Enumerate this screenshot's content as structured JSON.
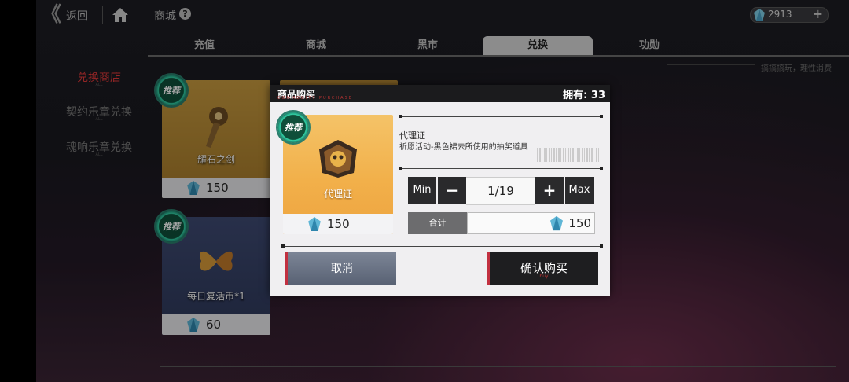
{
  "topbar": {
    "back_label": "返回",
    "mall_label": "商城",
    "currency_amount": "2913"
  },
  "tabs": [
    {
      "label": "充值"
    },
    {
      "label": "商城"
    },
    {
      "label": "黑市"
    },
    {
      "label": "兑换",
      "active": true
    },
    {
      "label": "功勋"
    }
  ],
  "tagline": "搞搞搞玩，理性消费",
  "side_menu": [
    {
      "label": "兑换商店",
      "sub": "ALL",
      "active": true
    },
    {
      "label": "契约乐章兑换",
      "sub": "ALL"
    },
    {
      "label": "魂响乐章兑换",
      "sub": "ALL"
    }
  ],
  "cards": [
    {
      "badge": "推荐",
      "name": "耀石之剑",
      "price": "150"
    },
    {
      "badge": "推荐",
      "name": "每日复活币*1",
      "price": "60"
    }
  ],
  "modal": {
    "title": "商品购买",
    "subtitle": "COMMODITY PURCHASE",
    "owned": "拥有: 33",
    "item": {
      "badge": "推荐",
      "name": "代理证",
      "price": "150"
    },
    "desc_name": "代理证",
    "desc_text": "祈愿活动-黑色裙去所使用的抽奖道具",
    "min_label": "Min",
    "minus_label": "−",
    "quantity": "1/19",
    "plus_label": "+",
    "max_label": "Max",
    "total_label": "合计",
    "total_value": "150",
    "cancel_label": "取消",
    "confirm_label": "确认购买",
    "confirm_sub": "buy"
  },
  "colors": {
    "accent_red": "#c23040",
    "badge_green": "#33d2a7"
  }
}
